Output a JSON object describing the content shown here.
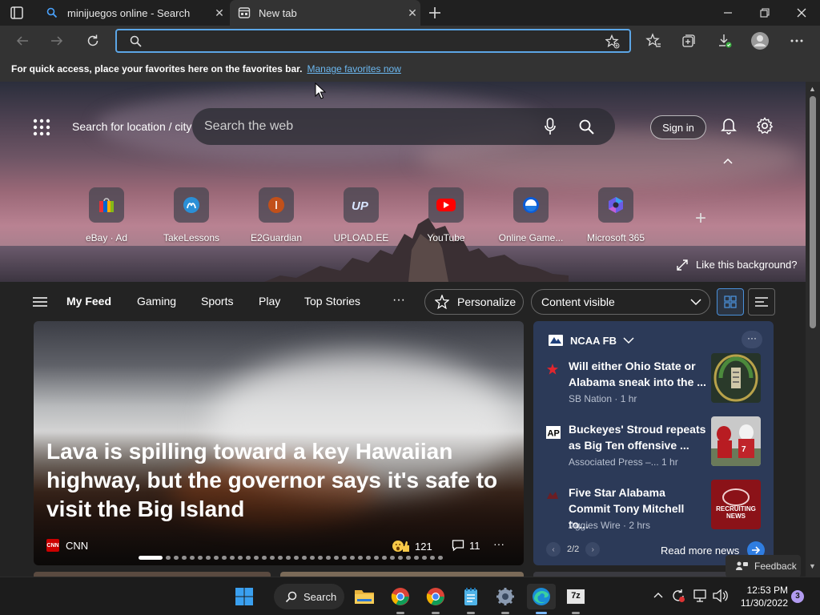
{
  "tabs": [
    {
      "title": "minijuegos online - Search",
      "icon": "search-icon"
    },
    {
      "title": "New tab",
      "icon": "newtab-icon"
    }
  ],
  "address": {
    "value": "",
    "placeholder": ""
  },
  "favorites_bar": {
    "message": "For quick access, place your favorites here on the favorites bar.",
    "link": "Manage favorites now"
  },
  "header": {
    "location": "Search for location / city",
    "search_placeholder": "Search the web",
    "sign_in": "Sign in"
  },
  "quick_links": [
    {
      "label": "eBay · Ad",
      "icon": "ebay-icon"
    },
    {
      "label": "TakeLessons",
      "icon": "takelessons-icon"
    },
    {
      "label": "E2Guardian",
      "icon": "e2guardian-icon"
    },
    {
      "label": "UPLOAD.EE",
      "icon": "upload-ee-icon"
    },
    {
      "label": "YouTube",
      "icon": "youtube-icon"
    },
    {
      "label": "Online Game...",
      "icon": "online-games-icon"
    },
    {
      "label": "Microsoft 365",
      "icon": "microsoft365-icon"
    }
  ],
  "background": {
    "like_text": "Like this background?"
  },
  "feed_nav": {
    "items": [
      "My Feed",
      "Gaming",
      "Sports",
      "Play",
      "Top Stories"
    ],
    "personalize": "Personalize",
    "content_visibility": "Content visible"
  },
  "main_story": {
    "headline": "Lava is spilling toward a key Hawaiian highway, but the governor says it's safe to visit the Big Island",
    "source": "CNN",
    "source_logo": "CNN",
    "reactions": "121",
    "comments": "11",
    "carousel_dots": 36,
    "active_dot": 0
  },
  "sports": {
    "league": "NCAA FB",
    "items": [
      {
        "title": "Will either Ohio State or Alabama sneak into the ...",
        "source": "SB Nation · 1 hr",
        "icon": "star-icon"
      },
      {
        "title": "Buckeyes' Stroud repeats as Big Ten offensive ...",
        "source": "Associated Press –... 1 hr",
        "icon": "ap-logo-icon"
      },
      {
        "title": "Five Star Alabama Commit Tony Mitchell to...",
        "source": "Aggies Wire · 2 hrs",
        "icon": "aggies-logo-icon"
      }
    ],
    "page": "2/2",
    "read_more": "Read more news",
    "thumb4_text": "RECRUITING NEWS"
  },
  "feedback": "Feedback",
  "taskbar": {
    "search_label": "Search",
    "time": "12:53 PM",
    "date": "11/30/2022",
    "notification_count": "3",
    "app_7zip": "7z"
  },
  "colors": {
    "accent": "#5ca6e6",
    "sports_card": "#2c3a58",
    "notif_badge": "#b29bf0"
  }
}
